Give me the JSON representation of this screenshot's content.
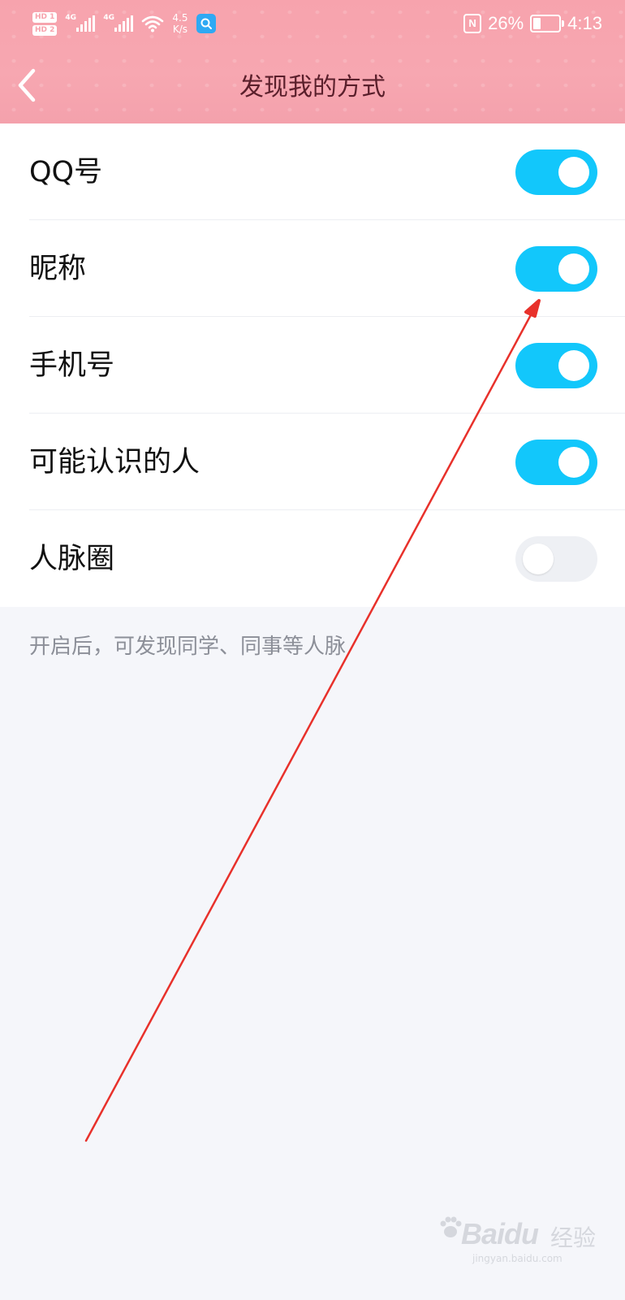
{
  "status_bar": {
    "hd1": "HD 1",
    "hd2": "HD 2",
    "net1": "4G",
    "net2": "4G",
    "speed_value": "4.5",
    "speed_unit": "K/s",
    "battery": "26%",
    "time": "4:13",
    "nfc": "N"
  },
  "nav": {
    "title": "发现我的方式",
    "back_icon": "chevron-left-icon"
  },
  "settings": [
    {
      "label": "QQ号",
      "enabled": true
    },
    {
      "label": "昵称",
      "enabled": true
    },
    {
      "label": "手机号",
      "enabled": true
    },
    {
      "label": "可能认识的人",
      "enabled": true
    },
    {
      "label": "人脉圈",
      "enabled": false
    }
  ],
  "hint": "开启后，可发现同学、同事等人脉",
  "colors": {
    "header": "#f7a3ad",
    "toggle_on": "#12c7fb",
    "toggle_off": "#eef0f4",
    "annotation": "#e8312b"
  },
  "watermark": {
    "brand": "Bai",
    "brand2": "du",
    "suffix": "经验",
    "url": "jingyan.baidu.com"
  }
}
